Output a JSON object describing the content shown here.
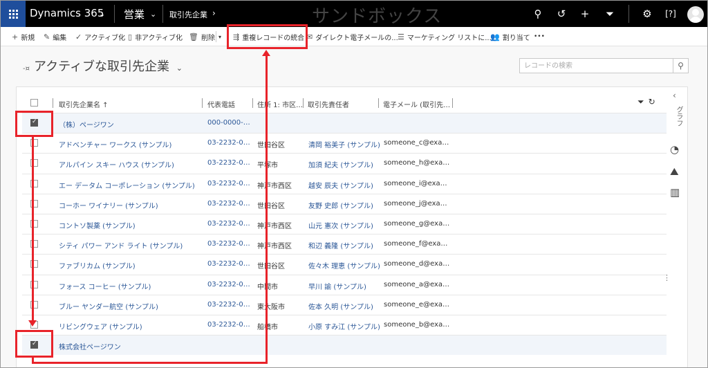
{
  "topbar": {
    "app_title": "Dynamics 365",
    "area": "営業",
    "breadcrumb": "取引先企業",
    "sandbox_label": "サンドボックス"
  },
  "commands": {
    "new": "新規",
    "edit": "編集",
    "activate": "アクティブ化",
    "deactivate": "非アクティブ化",
    "delete": "削除",
    "merge": "重複レコードの統合",
    "direct_email": "ダイレクト電子メールの...",
    "marketing_list": "マーケティング リストに...",
    "assign": "割り当て",
    "more": "•••"
  },
  "view": {
    "title": "アクティブな取引先企業",
    "search_placeholder": "レコードの検索"
  },
  "grid": {
    "columns": {
      "name": "取引先企業名 ↑",
      "phone": "代表電話",
      "address": "住所 1: 市区…",
      "owner": "取引先責任者",
      "email": "電子メール (取引先…"
    },
    "rows": [
      {
        "name": "（株）ページワン",
        "phone": "000-0000-…",
        "address": "",
        "owner": "",
        "email": "",
        "checked": true
      },
      {
        "name": "アドベンチャー ワークス (サンプル)",
        "phone": "03-2232-0…",
        "address": "世田谷区",
        "owner": "清岡 裕美子 (サンプル)",
        "email": "someone_c@exa…",
        "checked": false
      },
      {
        "name": "アルパイン スキー ハウス (サンプル)",
        "phone": "03-2232-0…",
        "address": "平塚市",
        "owner": "加須 紀夫 (サンプル)",
        "email": "someone_h@exa…",
        "checked": false
      },
      {
        "name": "エー データム コーポレーション (サンプル)",
        "phone": "03-2232-0…",
        "address": "神戸市西区",
        "owner": "越安 辰夫 (サンプル)",
        "email": "someone_i@exa…",
        "checked": false
      },
      {
        "name": "コーホー ワイナリー (サンプル)",
        "phone": "03-2232-0…",
        "address": "世田谷区",
        "owner": "友野 史郎 (サンプル)",
        "email": "someone_j@exa…",
        "checked": false
      },
      {
        "name": "コントソ製薬 (サンプル)",
        "phone": "03-2232-0…",
        "address": "神戸市西区",
        "owner": "山元 憲次 (サンプル)",
        "email": "someone_g@exa…",
        "checked": false
      },
      {
        "name": "シティ パワー アンド ライト (サンプル)",
        "phone": "03-2232-0…",
        "address": "神戸市西区",
        "owner": "和辺 義隆 (サンプル)",
        "email": "someone_f@exa…",
        "checked": false
      },
      {
        "name": "ファブリカム (サンプル)",
        "phone": "03-2232-0…",
        "address": "世田谷区",
        "owner": "佐々木 理恵 (サンプル)",
        "email": "someone_d@exa…",
        "checked": false
      },
      {
        "name": "フォース コーヒー (サンプル)",
        "phone": "03-2232-0…",
        "address": "中間市",
        "owner": "早川 諭 (サンプル)",
        "email": "someone_a@exa…",
        "checked": false
      },
      {
        "name": "ブルー ヤンダー航空 (サンプル)",
        "phone": "03-2232-0…",
        "address": "東大阪市",
        "owner": "佐本 久明 (サンプル)",
        "email": "someone_e@exa…",
        "checked": false
      },
      {
        "name": "リビングウェア (サンプル)",
        "phone": "03-2232-0…",
        "address": "船橋市",
        "owner": "小原 すみ江 (サンプル)",
        "email": "someone_b@exa…",
        "checked": false
      },
      {
        "name": "株式会社ページワン",
        "phone": "",
        "address": "",
        "owner": "",
        "email": "",
        "checked": true
      }
    ]
  },
  "side_panel": {
    "label": "グラフ"
  },
  "colors": {
    "annotation": "#e8232a",
    "link": "#2b5797",
    "topbar": "#000000",
    "waffle": "#1f4e9c"
  }
}
